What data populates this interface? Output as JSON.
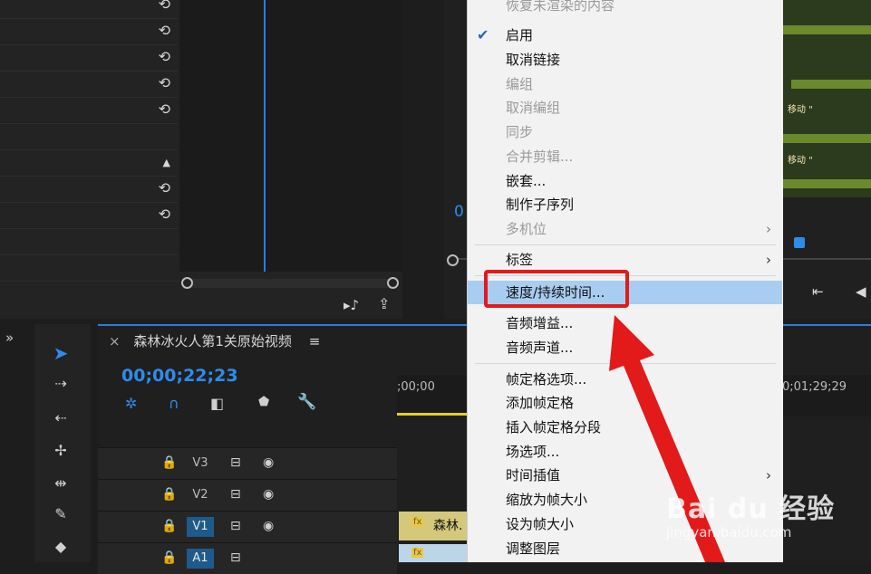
{
  "effect_controls": {
    "reset_icon": "reset-icon",
    "collapse_icon": "triangle-up-icon",
    "audio_out_icon": "play-audio-icon",
    "export_icon": "export-icon"
  },
  "program_monitor": {
    "timecode": "0",
    "game_texts": [
      "移动 \"",
      "移动 \""
    ],
    "step_icon": "step-back-icon"
  },
  "sidebar": {
    "expand_label": "»"
  },
  "timeline": {
    "close_glyph": "×",
    "sequence_name": "森林冰火人第1关原始视频",
    "menu_glyph": "≡",
    "timecode": "00;00;22;23",
    "ruler_start": ";00;00",
    "ruler_end": "0;01;29;29",
    "tracks": [
      "V3",
      "V2",
      "V1",
      "A1"
    ],
    "clip_label": "森林."
  },
  "context_menu": {
    "top_cut": "恢复未渲染的内容",
    "items": [
      {
        "label": "启用",
        "checked": true
      },
      {
        "label": "取消链接"
      },
      {
        "label": "编组",
        "disabled": true
      },
      {
        "label": "取消编组",
        "disabled": true
      },
      {
        "label": "同步",
        "disabled": true
      },
      {
        "label": "合并剪辑...",
        "disabled": true
      },
      {
        "label": "嵌套..."
      },
      {
        "label": "制作子序列"
      },
      {
        "label": "多机位",
        "disabled": true,
        "submenu": true
      },
      {
        "label": "标签",
        "submenu": true
      },
      {
        "label": "速度/持续时间...",
        "highlighted": true
      },
      {
        "label": "音频增益..."
      },
      {
        "label": "音频声道..."
      },
      {
        "label": "帧定格选项..."
      },
      {
        "label": "添加帧定格"
      },
      {
        "label": "插入帧定格分段"
      },
      {
        "label": "场选项..."
      },
      {
        "label": "时间插值",
        "submenu": true
      },
      {
        "label": "缩放为帧大小"
      },
      {
        "label": "设为帧大小"
      },
      {
        "label": "调整图层"
      }
    ]
  },
  "watermark": {
    "main": "Bai du 经验",
    "sub": "jingyan.baidu.com"
  },
  "colors": {
    "accent": "#2d8ceb",
    "highlight_box": "#e21a1a",
    "menu_selection": "#a8cdf0"
  }
}
